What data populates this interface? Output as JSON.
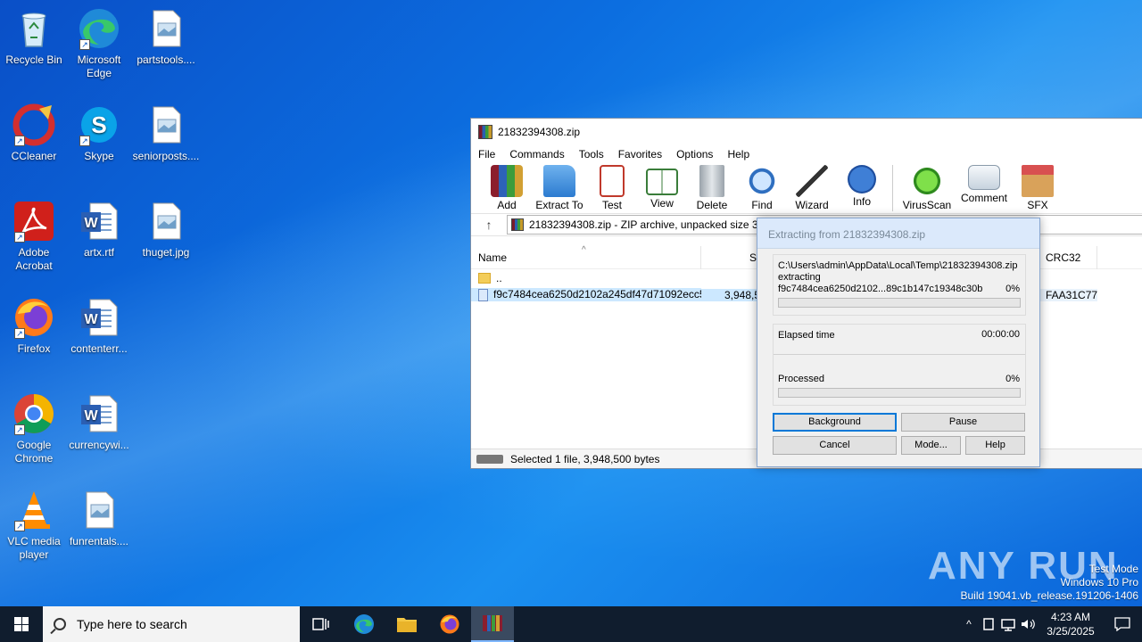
{
  "desktop": {
    "icons": [
      {
        "label": "Recycle Bin"
      },
      {
        "label": "Microsoft Edge"
      },
      {
        "label": "partstools...."
      },
      {
        "label": "CCleaner"
      },
      {
        "label": "Skype"
      },
      {
        "label": "seniorposts...."
      },
      {
        "label": "Adobe Acrobat"
      },
      {
        "label": "artx.rtf"
      },
      {
        "label": "thuget.jpg"
      },
      {
        "label": "Firefox"
      },
      {
        "label": "contenterr..."
      },
      {
        "label": "Google Chrome"
      },
      {
        "label": "currencywi..."
      },
      {
        "label": "VLC media player"
      },
      {
        "label": "funrentals...."
      }
    ]
  },
  "winrar": {
    "title": "21832394308.zip",
    "menu": [
      "File",
      "Commands",
      "Tools",
      "Favorites",
      "Options",
      "Help"
    ],
    "toolbar": [
      "Add",
      "Extract To",
      "Test",
      "View",
      "Delete",
      "Find",
      "Wizard",
      "Info",
      "VirusScan",
      "Comment",
      "SFX"
    ],
    "address": "21832394308.zip - ZIP archive, unpacked size 3",
    "columns": {
      "name": "Name",
      "size": "Si",
      "crc": "CRC32"
    },
    "rows": [
      {
        "name": "..",
        "size": "",
        "crc": ""
      },
      {
        "name": "f9c7484cea6250d2102a245df47d71092ecc5...",
        "size": "3,948,5",
        "crc": "FAA31C77"
      }
    ],
    "status": "Selected 1 file, 3,948,500 bytes"
  },
  "dialog": {
    "title": "Extracting from 21832394308.zip",
    "path": "C:\\Users\\admin\\AppData\\Local\\Temp\\21832394308.zip",
    "action": "extracting",
    "file": "f9c7484cea6250d2102...89c1b147c19348c30b",
    "file_pct": "0%",
    "elapsed_label": "Elapsed time",
    "elapsed_value": "00:00:00",
    "processed_label": "Processed",
    "processed_pct": "0%",
    "file_progress": 0,
    "processed_progress": 0,
    "buttons": {
      "background": "Background",
      "pause": "Pause",
      "cancel": "Cancel",
      "mode": "Mode...",
      "help": "Help"
    }
  },
  "taskbar": {
    "search_placeholder": "Type here to search",
    "time": "4:23 AM",
    "date": "3/25/2025"
  },
  "watermark": {
    "brand": "ANY RUN",
    "line1": "Test Mode",
    "line2": "Windows 10 Pro",
    "line3": "Build 19041.vb_release.191206-1406"
  }
}
